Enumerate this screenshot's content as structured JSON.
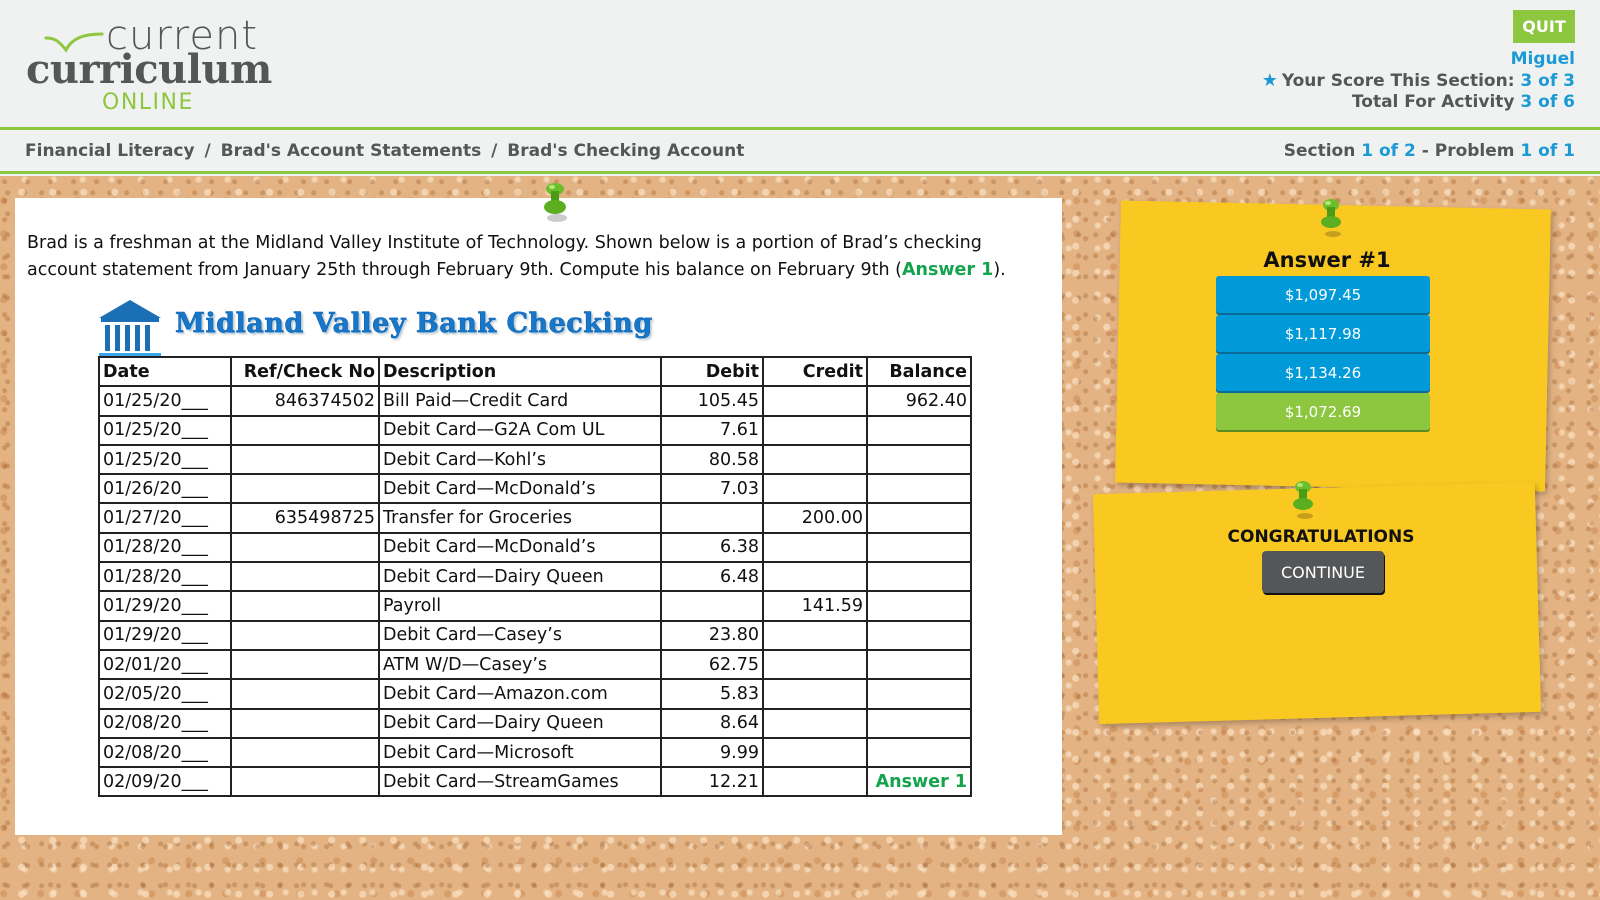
{
  "header": {
    "logo": {
      "line1": "current",
      "line2": "curriculum",
      "line3": "ONLINE"
    },
    "quit_label": "QUIT",
    "user_name": "Miguel",
    "score_label": "Your Score This Section:",
    "score_value": "3 of 3",
    "total_label": "Total For Activity",
    "total_value": "3 of 6"
  },
  "breadcrumb": {
    "items": [
      "Financial Literacy",
      "Brad's Account Statements",
      "Brad's Checking Account"
    ],
    "separator": "/"
  },
  "progress": {
    "section_label": "Section",
    "section_value": "1 of 2",
    "dash": "-",
    "problem_label": "Problem",
    "problem_value": "1 of 1"
  },
  "question": {
    "text_before": "Brad is a freshman at the Midland Valley Institute of Technology. Shown below is a portion of Brad’s checking account statement from January 25th through February 9th. Compute his balance on February 9th (",
    "answer_ref": "Answer 1",
    "text_after": ")."
  },
  "statement": {
    "title": "Midland Valley Bank Checking",
    "columns": [
      "Date",
      "Ref/Check No",
      "Description",
      "Debit",
      "Credit",
      "Balance"
    ],
    "rows": [
      {
        "date": "01/25/20___",
        "ref": "846374502",
        "desc": "Bill Paid—Credit Card",
        "debit": "105.45",
        "credit": "",
        "balance": "962.40"
      },
      {
        "date": "01/25/20___",
        "ref": "",
        "desc": "Debit Card—G2A Com UL",
        "debit": "7.61",
        "credit": "",
        "balance": ""
      },
      {
        "date": "01/25/20___",
        "ref": "",
        "desc": "Debit Card—Kohl’s",
        "debit": "80.58",
        "credit": "",
        "balance": ""
      },
      {
        "date": "01/26/20___",
        "ref": "",
        "desc": "Debit Card—McDonald’s",
        "debit": "7.03",
        "credit": "",
        "balance": ""
      },
      {
        "date": "01/27/20___",
        "ref": "635498725",
        "desc": "Transfer for Groceries",
        "debit": "",
        "credit": "200.00",
        "balance": ""
      },
      {
        "date": "01/28/20___",
        "ref": "",
        "desc": "Debit Card—McDonald’s",
        "debit": "6.38",
        "credit": "",
        "balance": ""
      },
      {
        "date": "01/28/20___",
        "ref": "",
        "desc": "Debit Card—Dairy Queen",
        "debit": "6.48",
        "credit": "",
        "balance": ""
      },
      {
        "date": "01/29/20___",
        "ref": "",
        "desc": "Payroll",
        "debit": "",
        "credit": "141.59",
        "balance": ""
      },
      {
        "date": "01/29/20___",
        "ref": "",
        "desc": "Debit Card—Casey’s",
        "debit": "23.80",
        "credit": "",
        "balance": ""
      },
      {
        "date": "02/01/20___",
        "ref": "",
        "desc": "ATM W/D—Casey’s",
        "debit": "62.75",
        "credit": "",
        "balance": ""
      },
      {
        "date": "02/05/20___",
        "ref": "",
        "desc": "Debit Card—Amazon.com",
        "debit": "5.83",
        "credit": "",
        "balance": ""
      },
      {
        "date": "02/08/20___",
        "ref": "",
        "desc": "Debit Card—Dairy Queen",
        "debit": "8.64",
        "credit": "",
        "balance": ""
      },
      {
        "date": "02/08/20___",
        "ref": "",
        "desc": "Debit Card—Microsoft",
        "debit": "9.99",
        "credit": "",
        "balance": ""
      },
      {
        "date": "02/09/20___",
        "ref": "",
        "desc": "Debit Card—StreamGames",
        "debit": "12.21",
        "credit": "",
        "balance": "Answer 1"
      }
    ]
  },
  "answer_panel": {
    "heading": "Answer #1",
    "choices": [
      {
        "label": "$1,097.45",
        "state": "default"
      },
      {
        "label": "$1,117.98",
        "state": "default"
      },
      {
        "label": "$1,134.26",
        "state": "default"
      },
      {
        "label": "$1,072.69",
        "state": "correct"
      }
    ]
  },
  "result_panel": {
    "message": "CONGRATULATIONS",
    "continue_label": "CONTINUE"
  },
  "colors": {
    "brand_green": "#8dc63f",
    "brand_blue": "#1b9ad6",
    "choice_blue": "#009ad9",
    "answer_green": "#14a44d",
    "note_yellow": "#f9c922",
    "text_gray": "#555658"
  }
}
